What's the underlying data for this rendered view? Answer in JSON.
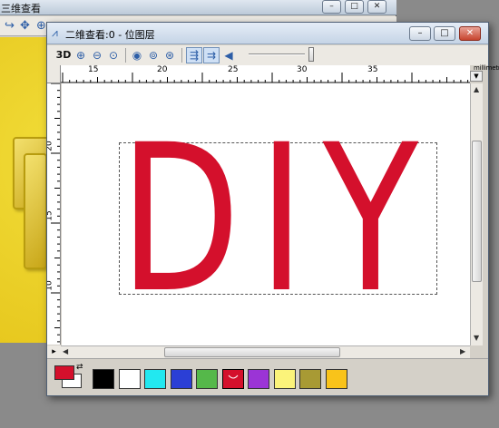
{
  "background_window": {
    "title": "三维查看"
  },
  "main_window": {
    "title": "二维查看:0 - 位图层",
    "controls": {
      "minimize": "–",
      "maximize": "□",
      "close": "✕"
    }
  },
  "toolbar": {
    "label_3d": "3D"
  },
  "rulers": {
    "horizontal_labels": [
      "15",
      "20",
      "25",
      "30",
      "35"
    ],
    "vertical_labels": [
      "20",
      "15",
      "10"
    ],
    "units": "millimetres"
  },
  "canvas": {
    "text": "DIY",
    "text_color": "#d4102c"
  },
  "palette": {
    "primary": "#d4102c",
    "secondary": "#ffffff",
    "swatches": [
      "#000000",
      "#ffffff",
      "#22e8f0",
      "#2b3fd6",
      "#55b84a",
      "#d4102c",
      "#9b34d6",
      "#fbf37a",
      "#a89a34",
      "#f9c31a"
    ]
  }
}
